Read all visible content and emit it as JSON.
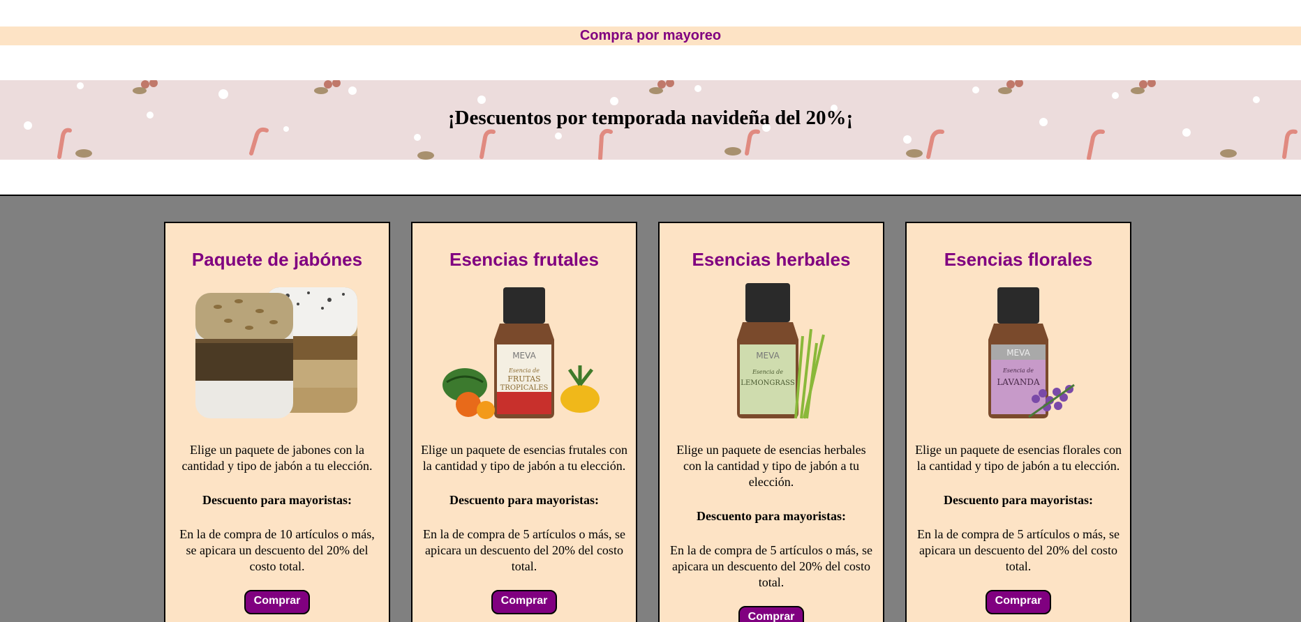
{
  "top_bar": {
    "label": "Compra por mayoreo"
  },
  "banner": {
    "title": "¡Descuentos por temporada navideña del 20%¡"
  },
  "cards": [
    {
      "title": "Paquete de jabónes",
      "image": "soap-bars-image",
      "description": "Elige un paquete de jabones con la cantidad y tipo de jabón a tu elección.",
      "discount_header": "Descuento para mayoristas:",
      "discount_text": "En la de compra de 10 artículos o más, se apicara un descuento del 20% del costo total.",
      "button": "Comprar"
    },
    {
      "title": "Esencias frutales",
      "image": "fruit-essence-bottle-image",
      "label_brand": "MEVA",
      "label_line1": "Esencia de",
      "label_line2": "FRUTAS",
      "label_line3": "TROPICALES",
      "description": "Elige un paquete de esencias frutales con la cantidad y tipo de jabón a tu elección.",
      "discount_header": "Descuento para mayoristas:",
      "discount_text": "En la de compra de 5 artículos o más, se apicara un descuento del 20% del costo total.",
      "button": "Comprar"
    },
    {
      "title": "Esencias herbales",
      "image": "herbal-essence-bottle-image",
      "label_brand": "MEVA",
      "label_line1": "Esencia de",
      "label_line2": "LEMONGRASS",
      "description": "Elige un paquete de esencias herbales con la cantidad y tipo de jabón a tu elección.",
      "discount_header": "Descuento para mayoristas:",
      "discount_text": "En la de compra de 5 artículos o más, se apicara un descuento del 20% del costo total.",
      "button": "Comprar"
    },
    {
      "title": "Esencias florales",
      "image": "floral-essence-bottle-image",
      "label_brand": "MEVA",
      "label_line1": "Esencia de",
      "label_line2": "LAVANDA",
      "description": "Elige un paquete de esencias florales con la cantidad y tipo de jabón a tu elección.",
      "discount_header": "Descuento para mayoristas:",
      "discount_text": "En la de compra de 5 artículos o más, se apicara un descuento del 20% del costo total.",
      "button": "Comprar"
    }
  ],
  "colors": {
    "accent": "#800080",
    "card_bg": "#fde3c5",
    "section_bg": "#808080",
    "banner_bg": "#ecdcdc"
  }
}
